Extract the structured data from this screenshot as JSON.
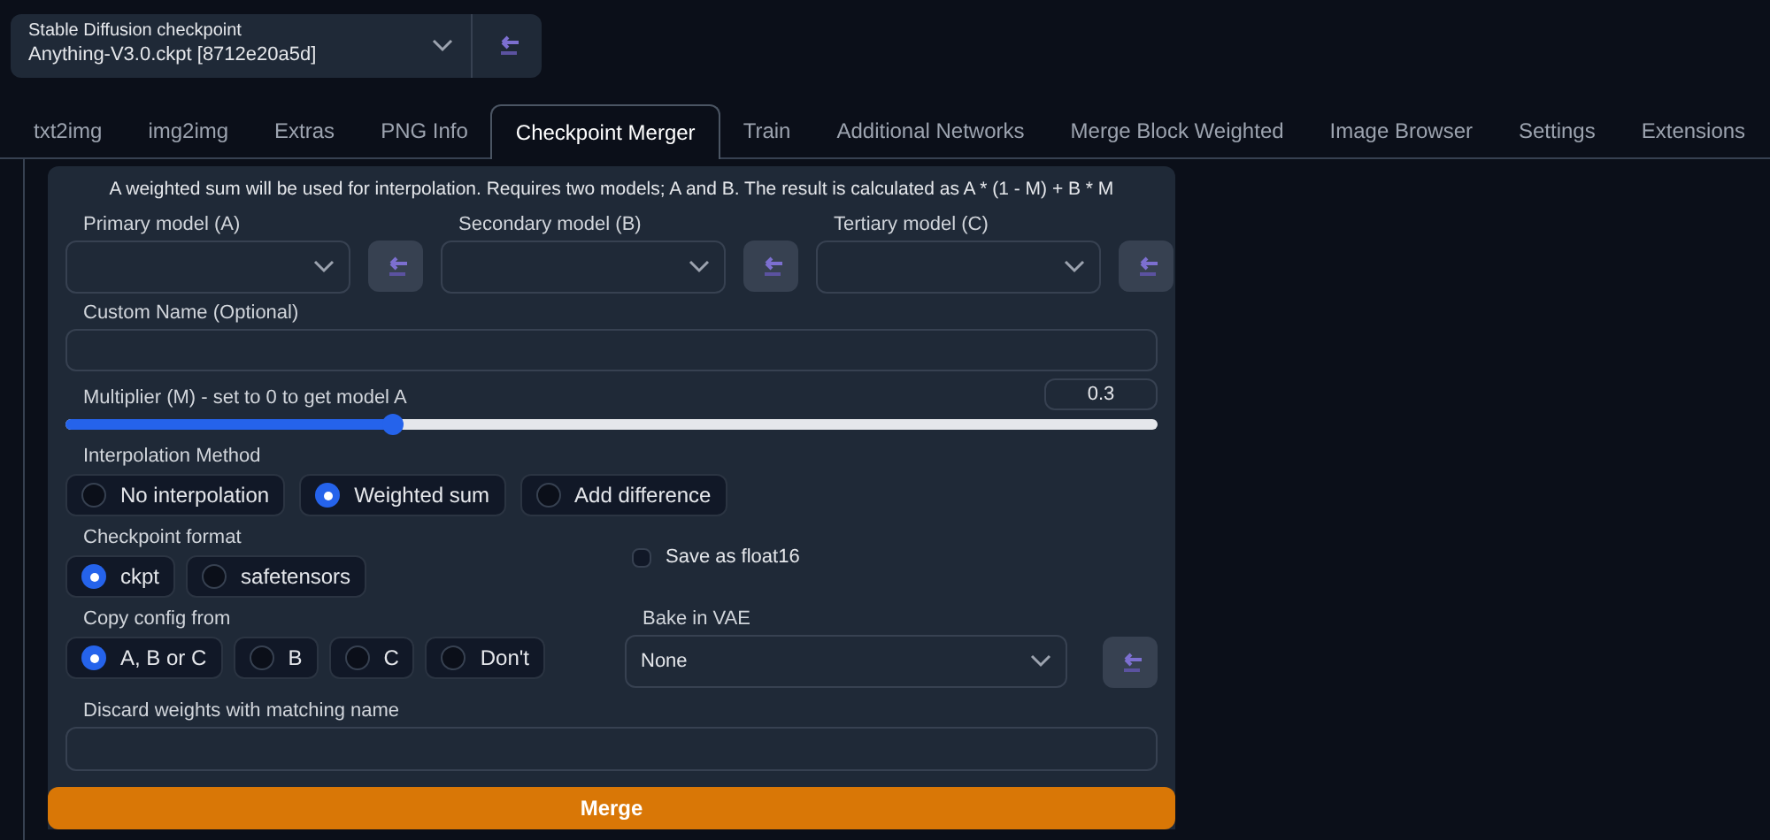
{
  "checkpoint": {
    "label": "Stable Diffusion checkpoint",
    "value": "Anything-V3.0.ckpt [8712e20a5d]"
  },
  "tabs": [
    {
      "label": "txt2img",
      "selected": false
    },
    {
      "label": "img2img",
      "selected": false
    },
    {
      "label": "Extras",
      "selected": false
    },
    {
      "label": "PNG Info",
      "selected": false
    },
    {
      "label": "Checkpoint Merger",
      "selected": true
    },
    {
      "label": "Train",
      "selected": false
    },
    {
      "label": "Additional Networks",
      "selected": false
    },
    {
      "label": "Merge Block Weighted",
      "selected": false
    },
    {
      "label": "Image Browser",
      "selected": false
    },
    {
      "label": "Settings",
      "selected": false
    },
    {
      "label": "Extensions",
      "selected": false
    }
  ],
  "description": "A weighted sum will be used for interpolation. Requires two models; A and B. The result is calculated as A * (1 - M) + B * M",
  "models": [
    {
      "label": "Primary model (A)"
    },
    {
      "label": "Secondary model (B)"
    },
    {
      "label": "Tertiary model (C)"
    }
  ],
  "custom_name": {
    "label": "Custom Name (Optional)"
  },
  "multiplier": {
    "label": "Multiplier (M) - set to 0 to get model A",
    "value": "0.3",
    "level": 0.3
  },
  "interpolation": {
    "label": "Interpolation Method",
    "options": [
      {
        "label": "No interpolation",
        "selected": false
      },
      {
        "label": "Weighted sum",
        "selected": true
      },
      {
        "label": "Add difference",
        "selected": false
      }
    ]
  },
  "checkpoint_format": {
    "label": "Checkpoint format",
    "options": [
      {
        "label": "ckpt",
        "selected": true
      },
      {
        "label": "safetensors",
        "selected": false
      }
    ]
  },
  "save_float16": {
    "label": "Save as float16",
    "checked": false
  },
  "copy_config": {
    "label": "Copy config from",
    "options": [
      {
        "label": "A, B or C",
        "selected": true
      },
      {
        "label": "B",
        "selected": false
      },
      {
        "label": "C",
        "selected": false
      },
      {
        "label": "Don't",
        "selected": false
      }
    ]
  },
  "bake_vae": {
    "label": "Bake in VAE",
    "value": "None"
  },
  "discard_weights": {
    "label": "Discard weights with matching name"
  },
  "merge_button": "Merge"
}
